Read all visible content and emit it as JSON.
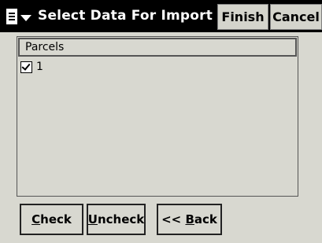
{
  "titlebar": {
    "title": "Select Data For Import",
    "finish_label": "Finish",
    "cancel_label": "Cancel",
    "menu_icon": "document-menu-icon"
  },
  "list": {
    "header": "Parcels",
    "items": [
      {
        "label": "1",
        "checked": true
      }
    ]
  },
  "buttons": {
    "check": {
      "mnemonic": "C",
      "rest": "heck"
    },
    "uncheck": {
      "mnemonic": "U",
      "rest": "ncheck"
    },
    "back": {
      "prefix": "<< ",
      "mnemonic": "B",
      "rest": "ack"
    }
  }
}
